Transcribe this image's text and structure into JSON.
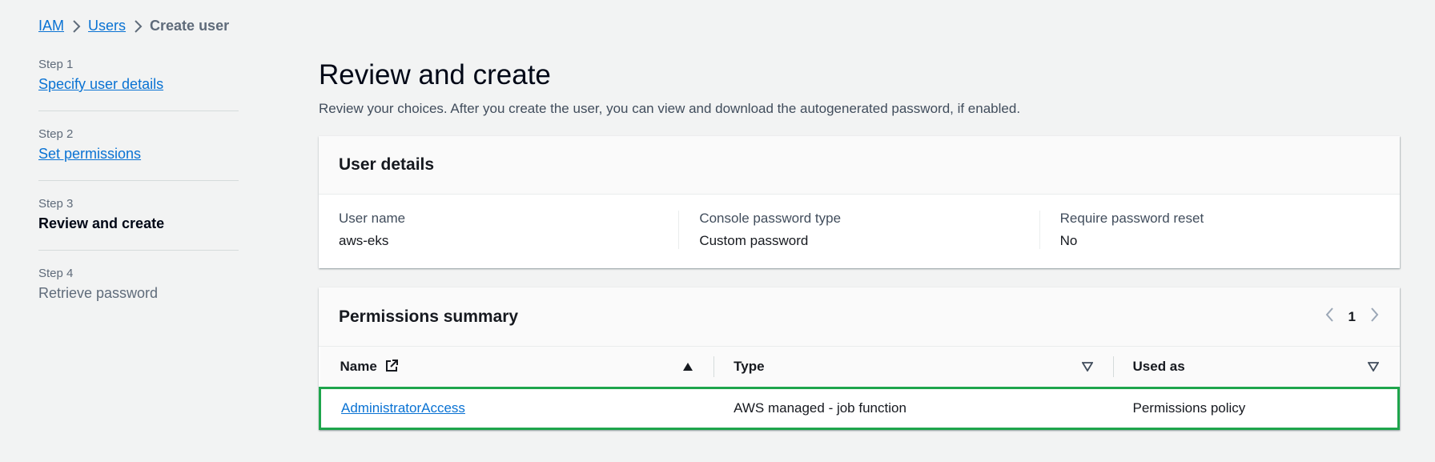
{
  "breadcrumb": {
    "items": [
      "IAM",
      "Users"
    ],
    "current": "Create user"
  },
  "steps": [
    {
      "num": "Step 1",
      "label": "Specify user details",
      "state": "link"
    },
    {
      "num": "Step 2",
      "label": "Set permissions",
      "state": "link"
    },
    {
      "num": "Step 3",
      "label": "Review and create",
      "state": "active"
    },
    {
      "num": "Step 4",
      "label": "Retrieve password",
      "state": "disabled"
    }
  ],
  "main": {
    "title": "Review and create",
    "description": "Review your choices. After you create the user, you can view and download the autogenerated password, if enabled."
  },
  "user_details": {
    "header": "User details",
    "fields": [
      {
        "key": "User name",
        "value": "aws-eks"
      },
      {
        "key": "Console password type",
        "value": "Custom password"
      },
      {
        "key": "Require password reset",
        "value": "No"
      }
    ]
  },
  "permissions": {
    "header": "Permissions summary",
    "page": "1",
    "columns": [
      "Name",
      "Type",
      "Used as"
    ],
    "rows": [
      {
        "name": "AdministratorAccess",
        "type": "AWS managed - job function",
        "used_as": "Permissions policy"
      }
    ]
  },
  "colors": {
    "link": "#0972d3",
    "highlight": "#1ea54c",
    "background": "#f2f3f3"
  }
}
